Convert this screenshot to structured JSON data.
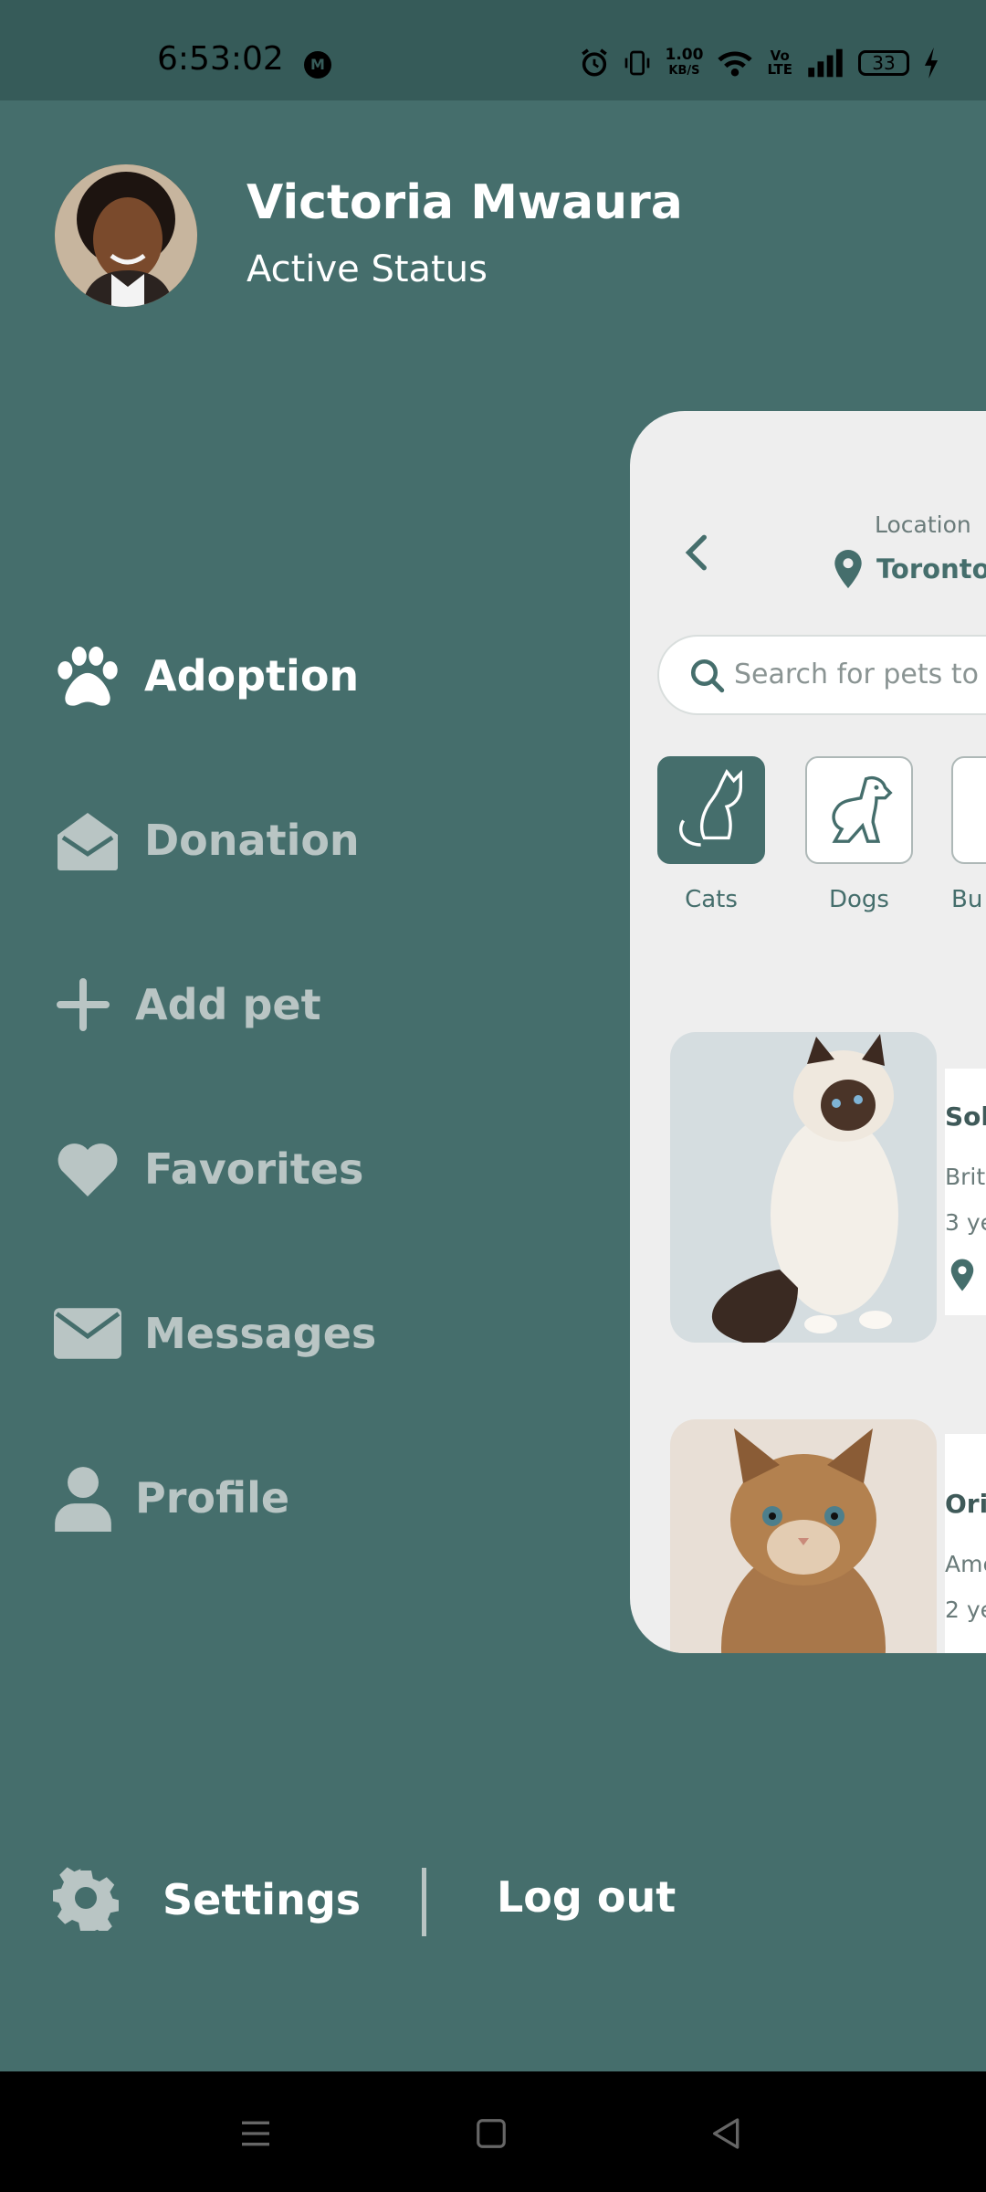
{
  "status_bar": {
    "time": "6:53:02",
    "notification": "M",
    "net_speed": "1.00",
    "net_unit": "KB/S",
    "volte_top": "Vo",
    "volte_bottom": "LTE",
    "battery": "33"
  },
  "profile": {
    "name": "Victoria Mwaura",
    "status": "Active Status"
  },
  "menu": {
    "items": [
      {
        "label": "Adoption",
        "icon": "paw-icon",
        "active": true
      },
      {
        "label": "Donation",
        "icon": "envelope-open-icon",
        "active": false
      },
      {
        "label": "Add pet",
        "icon": "plus-icon",
        "active": false
      },
      {
        "label": "Favorites",
        "icon": "heart-icon",
        "active": false
      },
      {
        "label": "Messages",
        "icon": "envelope-icon",
        "active": false
      },
      {
        "label": "Profile",
        "icon": "user-icon",
        "active": false
      }
    ]
  },
  "footer": {
    "settings_label": "Settings",
    "logout_label": "Log out"
  },
  "preview": {
    "location_label": "Location",
    "location_city": "Toronto",
    "search_placeholder": "Search for pets to ad",
    "categories": [
      {
        "label": "Cats",
        "icon": "cat-icon",
        "active": true
      },
      {
        "label": "Dogs",
        "icon": "dog-icon",
        "active": false
      },
      {
        "label": "Bu",
        "icon": "bird-icon",
        "active": false
      }
    ],
    "pets": [
      {
        "name": "Sol",
        "breed": "Brit",
        "age": "3 ye"
      },
      {
        "name": "Ori",
        "breed": "Ame",
        "age": "2 ye"
      }
    ]
  },
  "colors": {
    "background": "#456e6c",
    "status_bar": "#365b59",
    "active_text": "#ffffff",
    "inactive_text": "#b9c5c4",
    "card": "#eeeeee"
  }
}
